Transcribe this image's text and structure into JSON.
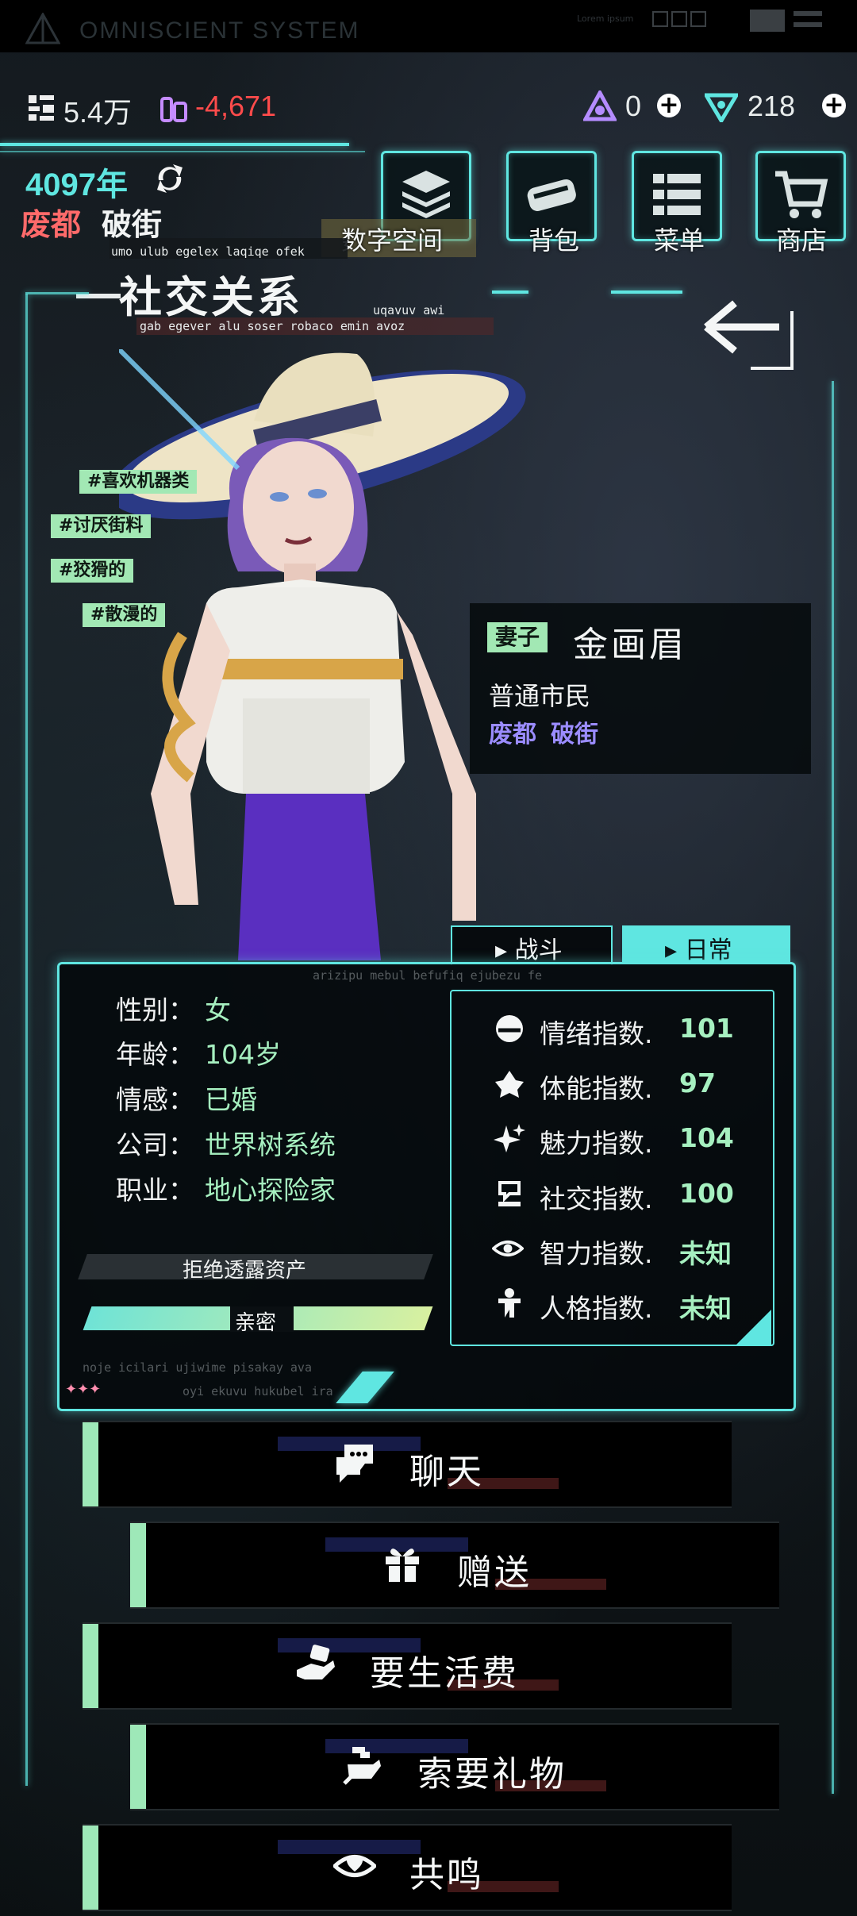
{
  "system": {
    "title": "OMNISCIENT SYSTEM",
    "lorem": "Lorem ipsum"
  },
  "currency": {
    "coins": "5.4万",
    "debt": "-4,671",
    "gems": "0",
    "tokens": "218"
  },
  "world": {
    "year": "4097年",
    "district": "废都",
    "street": "破街"
  },
  "nav": [
    {
      "label": "数字空间",
      "icon": "layers-icon"
    },
    {
      "label": "背包",
      "icon": "bag-icon"
    },
    {
      "label": "菜单",
      "icon": "menu-list-icon"
    },
    {
      "label": "商店",
      "icon": "cart-icon"
    }
  ],
  "page": {
    "title": "社交关系",
    "deco_top": "umo ulub egelex laqiqe ofek",
    "deco_right": "uqavuv awi",
    "deco_bottom": "gab egever alu soser robaco emin avoz"
  },
  "tags": [
    "#喜欢机器类",
    "#讨厌街料",
    "#狡猾的",
    "#散漫的"
  ],
  "character": {
    "relation": "妻子",
    "name": "金画眉",
    "class": "普通市民",
    "district": "废都",
    "street": "破街"
  },
  "tabs": {
    "combat": "战斗",
    "daily": "日常"
  },
  "panel_deco": {
    "top": "arizipu mebul befufiq ejubezu fe",
    "bottom1": "noje icilari ujiwime pisakay ava",
    "bottom2": "oyi ekuvu hukubel ira"
  },
  "profile": [
    {
      "key": "性别：",
      "value": "女"
    },
    {
      "key": "年龄：",
      "value": "104岁"
    },
    {
      "key": "情感：",
      "value": "已婚"
    },
    {
      "key": "公司：",
      "value": "世界树系统"
    },
    {
      "key": "职业：",
      "value": "地心探险家"
    }
  ],
  "asset_status": "拒绝透露资产",
  "intimacy": {
    "label": "亲密",
    "level": 1.0
  },
  "stats": [
    {
      "label": "情绪指数.",
      "value": "101",
      "icon": "mood-icon"
    },
    {
      "label": "体能指数.",
      "value": "97",
      "icon": "stamina-icon"
    },
    {
      "label": "魅力指数.",
      "value": "104",
      "icon": "sparkle-icon"
    },
    {
      "label": "社交指数.",
      "value": "100",
      "icon": "social-icon"
    },
    {
      "label": "智力指数.",
      "value": "未知",
      "icon": "eye-icon"
    },
    {
      "label": "人格指数.",
      "value": "未知",
      "icon": "person-icon"
    }
  ],
  "actions": [
    {
      "label": "聊天",
      "icon": "chat-icon"
    },
    {
      "label": "赠送",
      "icon": "gift-icon"
    },
    {
      "label": "要生活费",
      "icon": "hand-money-icon"
    },
    {
      "label": "索要礼物",
      "icon": "hand-gift-icon"
    },
    {
      "label": "共鸣",
      "icon": "resonance-eye-icon"
    }
  ],
  "colors": {
    "accent": "#5fe6e1",
    "mint": "#a2e8b4",
    "debt": "#ff4b4b",
    "district": "#9b8cff"
  }
}
